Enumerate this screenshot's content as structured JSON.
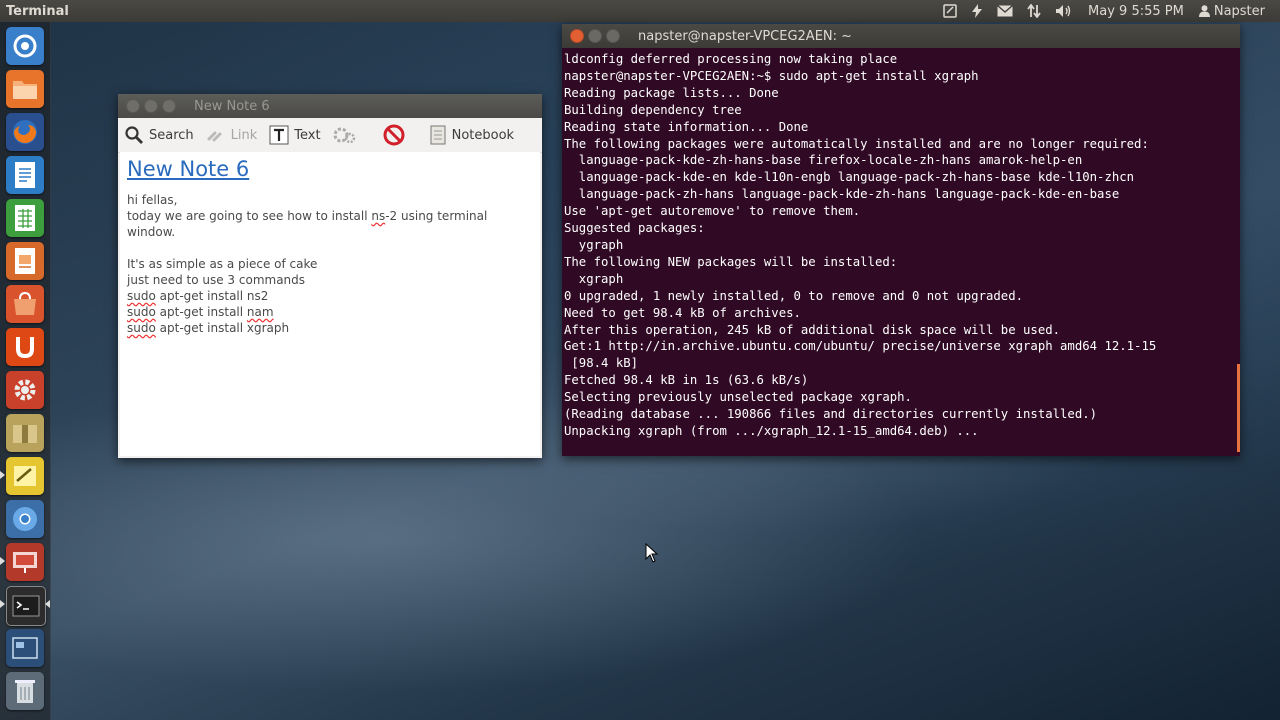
{
  "panel": {
    "app_title": "Terminal",
    "datetime": "May 9  5:55 PM",
    "user": "Napster",
    "icons": [
      "notes-indicator-icon",
      "power-charge-icon",
      "mail-icon",
      "network-icon",
      "volume-icon"
    ]
  },
  "launcher": {
    "items": [
      {
        "name": "dash-home-icon",
        "color": "#3a7fc9"
      },
      {
        "name": "files-icon",
        "color": "#e8742c"
      },
      {
        "name": "firefox-icon",
        "color": "#e66b1d"
      },
      {
        "name": "writer-icon",
        "color": "#2d7cc6"
      },
      {
        "name": "calc-icon",
        "color": "#3c9e3c"
      },
      {
        "name": "impress-icon",
        "color": "#d76a2a"
      },
      {
        "name": "software-center-icon",
        "color": "#d9532d"
      },
      {
        "name": "ubuntu-one-icon",
        "color": "#dd4814"
      },
      {
        "name": "system-settings-icon",
        "color": "#c9412b"
      },
      {
        "name": "archive-manager-icon",
        "color": "#b8a25c"
      },
      {
        "name": "tomboy-notes-icon",
        "color": "#e5c530"
      },
      {
        "name": "chromium-icon",
        "color": "#4a8fd8"
      },
      {
        "name": "presentation-icon",
        "color": "#c0392b"
      },
      {
        "name": "terminal-icon",
        "color": "#3a3a3a"
      },
      {
        "name": "workspace-switcher-icon",
        "color": "#2b4f78"
      },
      {
        "name": "trash-icon",
        "color": "#6f7f8c"
      }
    ]
  },
  "note": {
    "window_title": "New Note 6",
    "toolbar": {
      "search": "Search",
      "link": "Link",
      "text": "Text",
      "notebook": "Notebook"
    },
    "heading": "New Note 6",
    "lines": [
      "hi fellas,",
      "today we are going to see how to install ns-2 using terminal",
      "window."
    ],
    "lines2": [
      "It's as simple as a piece of cake",
      "just need to use 3 commands"
    ],
    "commands": [
      {
        "sudo": "sudo",
        "rest": " apt-get install ns2"
      },
      {
        "sudo": "sudo",
        "rest": " apt-get install ",
        "pkg": "nam"
      },
      {
        "sudo": "sudo",
        "rest": " apt-get install xgraph"
      }
    ]
  },
  "terminal": {
    "window_title": "napster@napster-VPCEG2AEN: ~",
    "lines": [
      "ldconfig deferred processing now taking place",
      "napster@napster-VPCEG2AEN:~$ sudo apt-get install xgraph",
      "Reading package lists... Done",
      "Building dependency tree",
      "Reading state information... Done",
      "The following packages were automatically installed and are no longer required:",
      "  language-pack-kde-zh-hans-base firefox-locale-zh-hans amarok-help-en",
      "  language-pack-kde-en kde-l10n-engb language-pack-zh-hans-base kde-l10n-zhcn",
      "  language-pack-zh-hans language-pack-kde-zh-hans language-pack-kde-en-base",
      "Use 'apt-get autoremove' to remove them.",
      "Suggested packages:",
      "  ygraph",
      "The following NEW packages will be installed:",
      "  xgraph",
      "0 upgraded, 1 newly installed, 0 to remove and 0 not upgraded.",
      "Need to get 98.4 kB of archives.",
      "After this operation, 245 kB of additional disk space will be used.",
      "Get:1 http://in.archive.ubuntu.com/ubuntu/ precise/universe xgraph amd64 12.1-15",
      " [98.4 kB]",
      "Fetched 98.4 kB in 1s (63.6 kB/s)",
      "Selecting previously unselected package xgraph.",
      "(Reading database ... 190866 files and directories currently installed.)",
      "Unpacking xgraph (from .../xgraph_12.1-15_amd64.deb) ..."
    ]
  }
}
